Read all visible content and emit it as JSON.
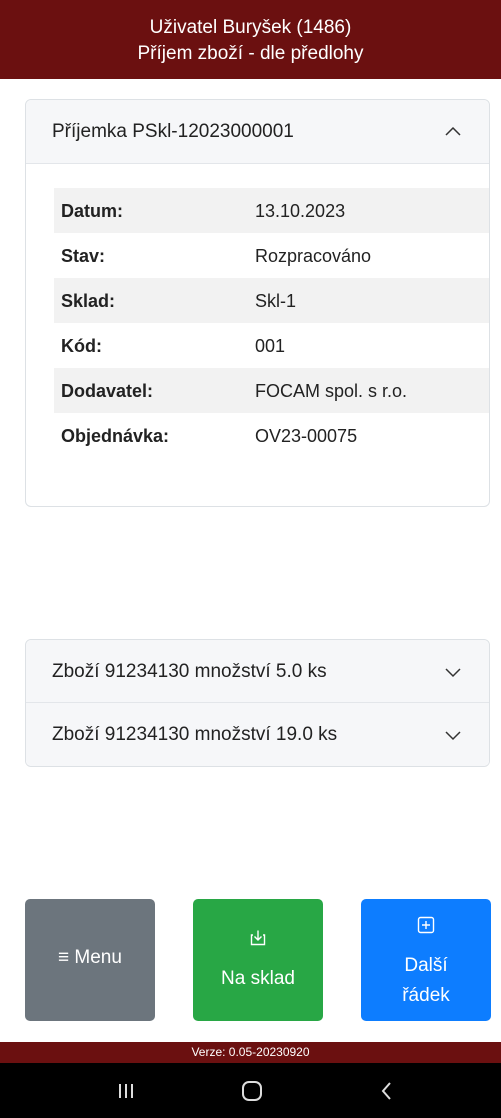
{
  "header": {
    "user_line": "Uživatel Buryšek (1486)",
    "screen_title": "Příjem zboží - dle předlohy"
  },
  "receipt": {
    "title": "Příjemka PSkl-12023000001",
    "expanded": true,
    "rows": [
      {
        "label": "Datum:",
        "value": "13.10.2023"
      },
      {
        "label": "Stav:",
        "value": "Rozpracováno"
      },
      {
        "label": "Sklad:",
        "value": "Skl-1"
      },
      {
        "label": "Kód:",
        "value": "001"
      },
      {
        "label": "Dodavatel:",
        "value": "FOCAM spol. s r.o."
      },
      {
        "label": "Objednávka:",
        "value": "OV23-00075"
      }
    ]
  },
  "items": [
    {
      "title": "Zboží 91234130 množství 5.0 ks",
      "expanded": false
    },
    {
      "title": "Zboží 91234130 množství 19.0 ks",
      "expanded": false
    }
  ],
  "buttons": {
    "menu": {
      "label": "≡  Menu",
      "color": "#6c757d"
    },
    "na_sklad": {
      "label": "Na sklad",
      "icon": "download-box-icon",
      "color": "#28a745"
    },
    "dalsi_radek": {
      "label_line1": "Další",
      "label_line2": "řádek",
      "icon": "plus-box-icon",
      "color": "#0d7dff"
    }
  },
  "footer": {
    "version": "Verze: 0.05-20230920"
  },
  "colors": {
    "header_bg": "#6b1010",
    "accordion_bg": "#f6f7f9",
    "stripe_bg": "#f2f2f2"
  }
}
